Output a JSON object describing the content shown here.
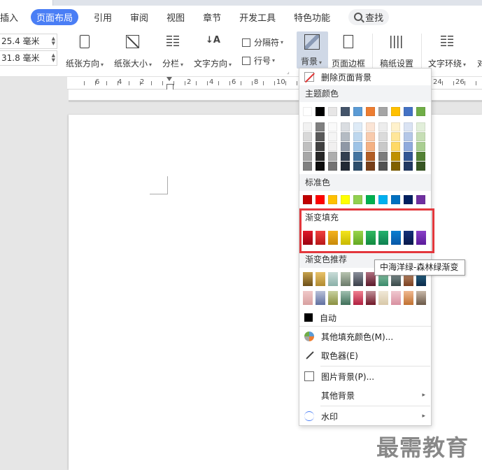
{
  "menubar": {
    "items": [
      "插入",
      "页面布局",
      "引用",
      "审阅",
      "视图",
      "章节",
      "开发工具",
      "特色功能"
    ],
    "active": "页面布局",
    "search_label": "查找"
  },
  "ribbon": {
    "margin_top": "25.4 毫米",
    "margin_bottom": "31.8 毫米",
    "buttons": {
      "orientation": "纸张方向",
      "size": "纸张大小",
      "columns": "分栏",
      "text_direction": "文字方向",
      "separator": "分隔符",
      "line_number": "行号",
      "background": "背景",
      "page_border": "页面边框",
      "grid_paper": "稿纸设置",
      "text_wrap": "文字环绕",
      "align": "对"
    }
  },
  "ruler": {
    "numbers": [
      "6",
      "4",
      "2",
      "2",
      "4",
      "6",
      "8",
      "10",
      "12",
      "14",
      "16",
      "18",
      "20",
      "22",
      "24",
      "26"
    ]
  },
  "dropdown": {
    "remove_bg": "删除页面背景",
    "theme_colors_title": "主题颜色",
    "standard_colors_title": "标准色",
    "gradient_fill_title": "渐变填充",
    "gradient_recommend_title": "渐变色推荐",
    "auto": "自动",
    "more_fill": "其他填充颜色(M)...",
    "eyedropper": "取色器(E)",
    "picture_bg": "图片背景(P)...",
    "other_bg": "其他背景",
    "watermark": "水印",
    "theme_top_row": [
      "#ffffff",
      "#000000",
      "#e7e6e6",
      "#44546a",
      "#5b9bd5",
      "#ed7d31",
      "#a5a5a5",
      "#ffc000",
      "#4472c4",
      "#70ad47"
    ],
    "standard_colors": [
      "#c00000",
      "#ff0000",
      "#ffc000",
      "#ffff00",
      "#92d050",
      "#00b050",
      "#00b0f0",
      "#0070c0",
      "#002060",
      "#7030a0"
    ],
    "gradient_colors": [
      [
        "#e0182a",
        "#9a0010"
      ],
      [
        "#f04040",
        "#b81818"
      ],
      [
        "#f3b21d",
        "#c98a0a"
      ],
      [
        "#f4e51e",
        "#c8b800"
      ],
      [
        "#9ad44a",
        "#62a822"
      ],
      [
        "#2db860",
        "#128a40"
      ],
      [
        "#23b26d",
        "#0f8050"
      ],
      [
        "#0b7fd0",
        "#0858a8"
      ],
      [
        "#13307a",
        "#08184a"
      ],
      [
        "#8a40c8",
        "#5a1c9a"
      ]
    ],
    "recommend_row1": [
      [
        "#c7a24c",
        "#6d4f18"
      ],
      [
        "#e8c26a",
        "#b08a30"
      ],
      [
        "#c9dcd8",
        "#8ab0a8"
      ],
      [
        "#b8c4b0",
        "#6a7a6a"
      ],
      [
        "#8a8f9a",
        "#3a3f4a"
      ],
      [
        "#b07080",
        "#5a1a2a"
      ],
      [
        "#8fc4a8",
        "#3a8a6a"
      ],
      [
        "#8a9a9a",
        "#3a4a4a"
      ],
      [
        "#c09070",
        "#7a4020"
      ],
      [
        "#2a6a8a",
        "#0a2a4a"
      ]
    ],
    "recommend_row2": [
      [
        "#f0c8c8",
        "#d8a0a0"
      ],
      [
        "#b8c0d8",
        "#6070a0"
      ],
      [
        "#c8d0a0",
        "#8a9040"
      ],
      [
        "#a0c0b0",
        "#40705a"
      ],
      [
        "#f08090",
        "#b02040"
      ],
      [
        "#c09098",
        "#701828"
      ],
      [
        "#f0e8d8",
        "#d8c8a8"
      ],
      [
        "#f0c8d0",
        "#d890a0"
      ],
      [
        "#f0b890",
        "#c07030"
      ],
      [
        "#c8b8a8",
        "#6a5848"
      ]
    ]
  },
  "tooltip": "中海洋绿-森林绿渐变",
  "watermark_logo": "最需教育"
}
